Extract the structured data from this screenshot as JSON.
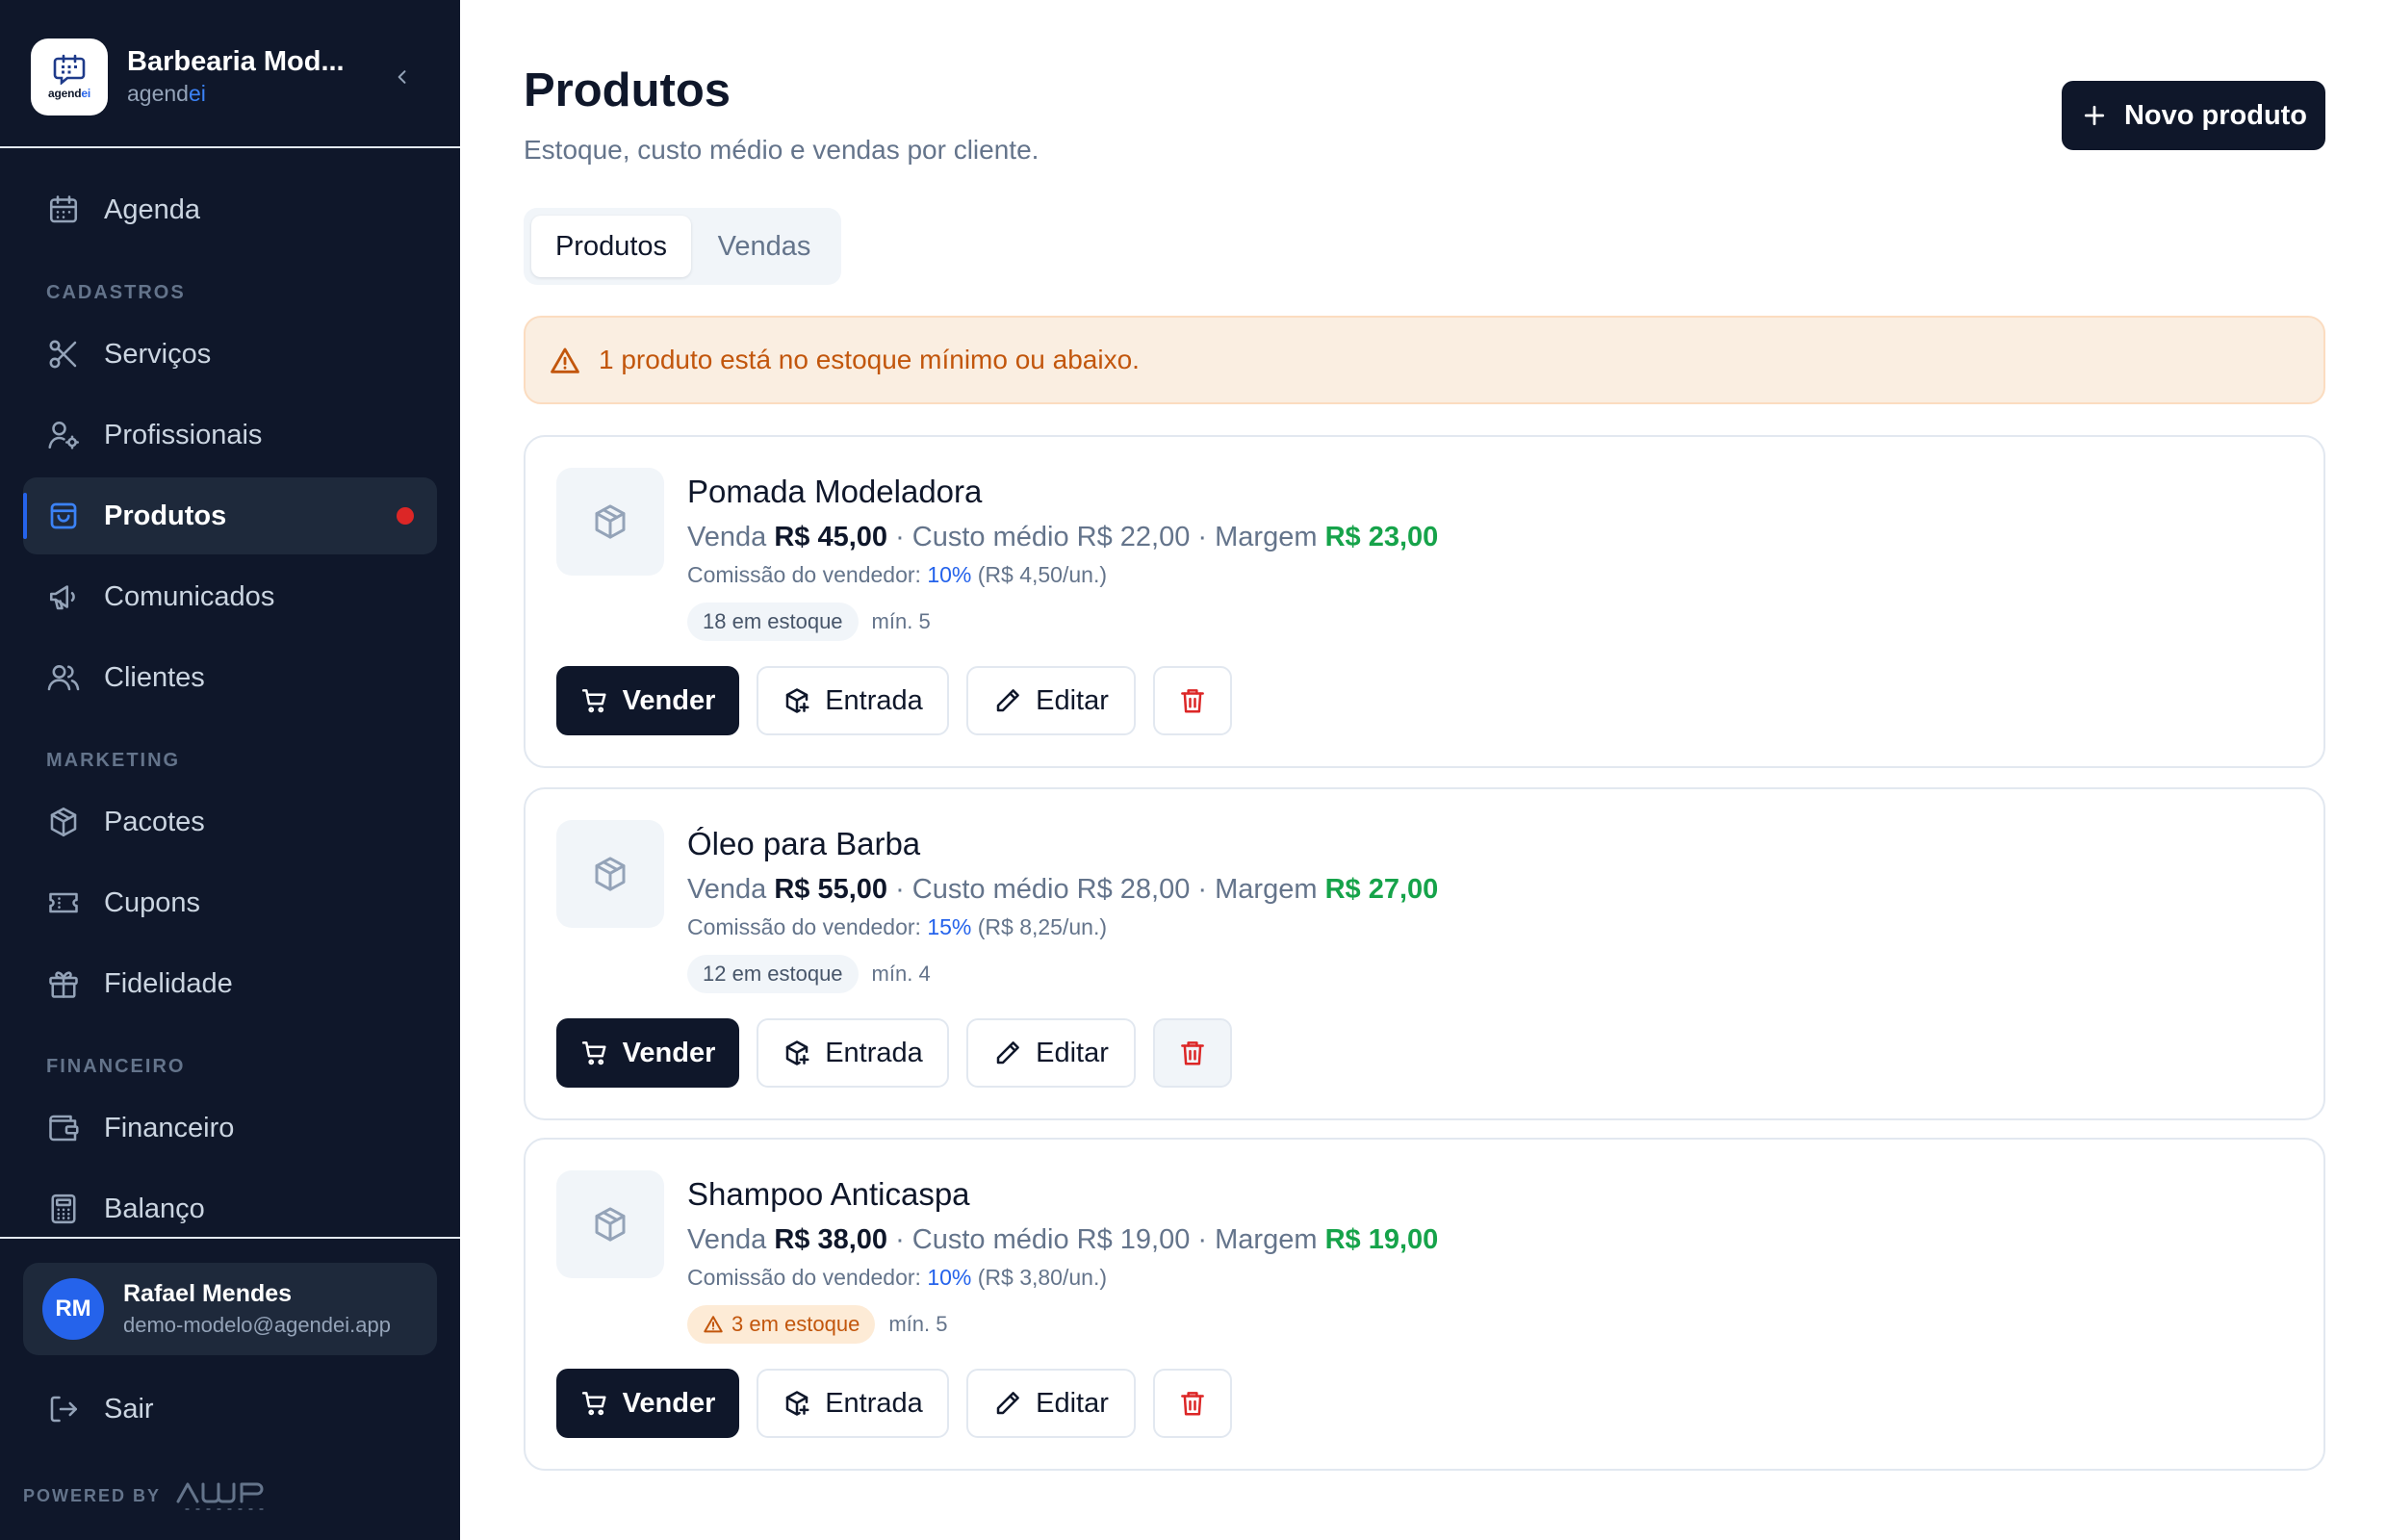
{
  "brand": {
    "name": "Barbearia Mod...",
    "sub_prefix": "agend",
    "sub_accent": "ei",
    "logo_prefix": "agend",
    "logo_accent": "ei"
  },
  "sidebar": {
    "items": [
      {
        "label": "Agenda",
        "icon": "calendar-icon"
      },
      {
        "label": "Serviços",
        "icon": "scissors-icon"
      },
      {
        "label": "Profissionais",
        "icon": "user-gear-icon"
      },
      {
        "label": "Produtos",
        "icon": "shopping-bag-icon",
        "active": true,
        "has_dot": true
      },
      {
        "label": "Comunicados",
        "icon": "megaphone-icon"
      },
      {
        "label": "Clientes",
        "icon": "users-icon"
      },
      {
        "label": "Pacotes",
        "icon": "package-icon"
      },
      {
        "label": "Cupons",
        "icon": "ticket-icon"
      },
      {
        "label": "Fidelidade",
        "icon": "gift-icon"
      },
      {
        "label": "Financeiro",
        "icon": "wallet-icon"
      },
      {
        "label": "Balanço",
        "icon": "calculator-icon"
      }
    ],
    "sections": [
      "CADASTROS",
      "MARKETING",
      "FINANCEIRO"
    ],
    "user": {
      "initials": "RM",
      "name": "Rafael Mendes",
      "email": "demo-modelo@agendei.app"
    },
    "logout_label": "Sair",
    "powered_by": "POWERED BY"
  },
  "header": {
    "title": "Produtos",
    "subtitle": "Estoque, custo médio e vendas por cliente.",
    "new_button_label": "Novo produto"
  },
  "tabs": [
    {
      "label": "Produtos",
      "active": true
    },
    {
      "label": "Vendas",
      "active": false
    }
  ],
  "alert": {
    "text": "1 produto está no estoque mínimo ou abaixo.",
    "icon": "warning-triangle-icon"
  },
  "products": [
    {
      "name": "Pomada Modeladora",
      "sale_label": "Venda",
      "sale_price": "R$ 45,00",
      "cost_text": "· Custo médio R$ 22,00 · Margem",
      "margin": "R$ 23,00",
      "commission_label": "Comissão do vendedor:",
      "commission_pct": "10%",
      "commission_value": "(R$ 4,50/un.)",
      "stock": "18 em estoque",
      "min": "mín. 5",
      "low_stock": false
    },
    {
      "name": "Óleo para Barba",
      "sale_label": "Venda",
      "sale_price": "R$ 55,00",
      "cost_text": "· Custo médio R$ 28,00 · Margem",
      "margin": "R$ 27,00",
      "commission_label": "Comissão do vendedor:",
      "commission_pct": "15%",
      "commission_value": "(R$ 8,25/un.)",
      "stock": "12 em estoque",
      "min": "mín. 4",
      "low_stock": false
    },
    {
      "name": "Shampoo Anticaspa",
      "sale_label": "Venda",
      "sale_price": "R$ 38,00",
      "cost_text": "· Custo médio R$ 19,00 · Margem",
      "margin": "R$ 19,00",
      "commission_label": "Comissão do vendedor:",
      "commission_pct": "10%",
      "commission_value": "(R$ 3,80/un.)",
      "stock": "3 em estoque",
      "min": "mín. 5",
      "low_stock": true
    }
  ],
  "card_actions": {
    "sell": "Vender",
    "entry": "Entrada",
    "edit": "Editar"
  },
  "colors": {
    "sidebar_bg": "#0f172a",
    "accent": "#2563eb",
    "margin_green": "#16a34a",
    "warning": "#c2560c",
    "danger": "#dc2626"
  }
}
